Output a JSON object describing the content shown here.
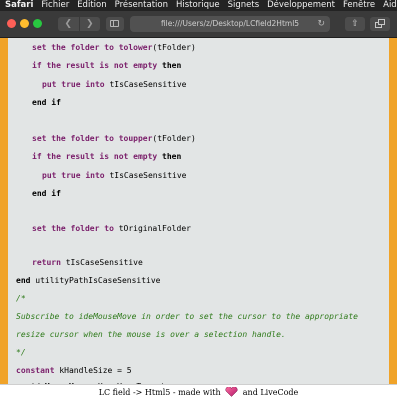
{
  "menubar": {
    "items": [
      "Safari",
      "Fichier",
      "Édition",
      "Présentation",
      "Historique",
      "Signets",
      "Développement",
      "Fenêtre",
      "Aide"
    ]
  },
  "toolbar": {
    "back_icon": "chevron-left-icon",
    "forward_icon": "chevron-right-icon",
    "url": "file:///Users/z/Desktop/LCfield2Html5",
    "reload_icon": "reload-icon",
    "share_icon": "share-icon",
    "tabs_icon": "tabs-overview-icon"
  },
  "code_lines": [
    {
      "tokens": [
        {
          "t": "set the folder to tolower",
          "s": "k"
        },
        {
          "t": "(tFolder)",
          "s": "p"
        }
      ]
    },
    {
      "tokens": [
        {
          "t": "if the result is not empty ",
          "s": "k"
        },
        {
          "t": "then",
          "s": "n"
        }
      ]
    },
    {
      "tokens": [
        {
          "t": "put true into ",
          "s": "k"
        },
        {
          "t": "tIsCaseSensitive",
          "s": "p"
        }
      ]
    },
    {
      "tokens": [
        {
          "t": "end if",
          "s": "n"
        }
      ]
    },
    {
      "tokens": [
        {
          "t": "set the folder to toupper",
          "s": "k"
        },
        {
          "t": "(tFolder)",
          "s": "p"
        }
      ]
    },
    {
      "tokens": [
        {
          "t": "if the result is not empty ",
          "s": "k"
        },
        {
          "t": "then",
          "s": "n"
        }
      ]
    },
    {
      "tokens": [
        {
          "t": "put true into ",
          "s": "k"
        },
        {
          "t": "tIsCaseSensitive",
          "s": "p"
        }
      ]
    },
    {
      "tokens": [
        {
          "t": "end if",
          "s": "n"
        }
      ]
    },
    {
      "tokens": [
        {
          "t": "set the folder to ",
          "s": "k"
        },
        {
          "t": "tOriginalFolder",
          "s": "p"
        }
      ]
    },
    {
      "tokens": [
        {
          "t": "return ",
          "s": "k"
        },
        {
          "t": "tIsCaseSensitive",
          "s": "p"
        }
      ]
    },
    {
      "tokens": [
        {
          "t": "end ",
          "s": "n"
        },
        {
          "t": "utilityPathIsCaseSensitive",
          "s": "p"
        }
      ]
    },
    {
      "tokens": [
        {
          "t": "/*",
          "s": "c"
        }
      ]
    },
    {
      "tokens": [
        {
          "t": "Subscribe to ideMouseMove in order to set the cursor to the appropriate",
          "s": "c"
        }
      ]
    },
    {
      "tokens": [
        {
          "t": "resize cursor when the mouse is over a selection handle.",
          "s": "c"
        }
      ]
    },
    {
      "tokens": [
        {
          "t": "*/",
          "s": "c"
        }
      ]
    },
    {
      "tokens": [
        {
          "t": "constant ",
          "s": "k"
        },
        {
          "t": "kHandleSize = 5",
          "s": "p"
        }
      ]
    },
    {
      "tokens": [
        {
          "t": "on ",
          "s": "n"
        },
        {
          "t": "ideMouseMove pX, pY, pTarget",
          "s": "p"
        }
      ]
    }
  ],
  "footer": {
    "text_before": "LC field -> Html5 - made with",
    "heart_icon": "heart-icon",
    "text_after": "and LiveCode"
  }
}
